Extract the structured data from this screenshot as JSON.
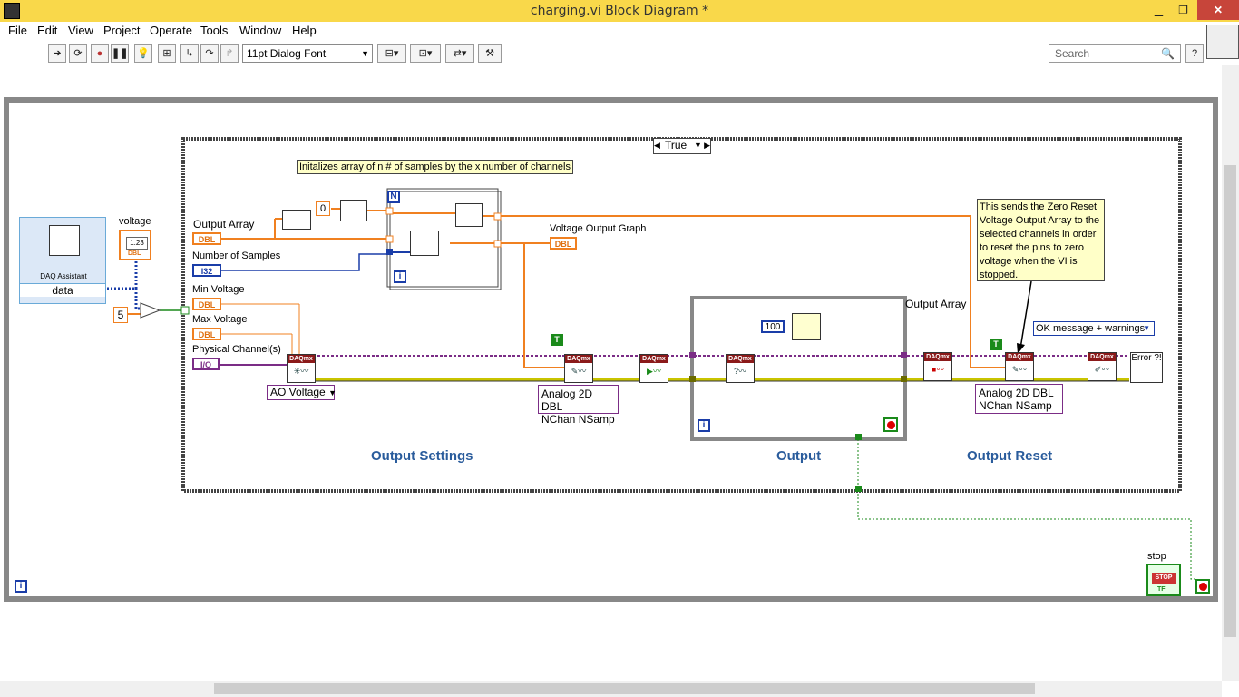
{
  "window": {
    "title": "charging.vi Block Diagram *",
    "minimize": "▁",
    "restore": "❐",
    "close": "✕"
  },
  "menu": [
    "File",
    "Edit",
    "View",
    "Project",
    "Operate",
    "Tools",
    "Window",
    "Help"
  ],
  "toolbar": {
    "font": "11pt Dialog Font",
    "search_placeholder": "Search"
  },
  "case_structure": {
    "selector": "True"
  },
  "comment": "Initalizes  array of n # of samples by the x number of channels",
  "note": "This sends the Zero Reset Voltage Output Array to the selected channels in order to reset the pins to zero voltage when the VI is stopped.",
  "labels": {
    "daq_assistant": "DAQ Assistant",
    "data": "data",
    "voltage": "voltage",
    "output_array": "Output Array",
    "output_array2": "Output Array",
    "number_of_samples": "Number of Samples",
    "min_voltage": "Min Voltage",
    "max_voltage": "Max Voltage",
    "physical_channels": "Physical Channel(s)",
    "voltage_output_graph": "Voltage Output Graph",
    "stop": "stop",
    "stop_btn": "STOP",
    "tf": "TF"
  },
  "constants": {
    "five": "5",
    "zero": "0",
    "hundred": "100",
    "true1": "T",
    "true2": "T"
  },
  "terminals": {
    "dbl": "DBL",
    "i32": "I32",
    "io": "I/O",
    "numeric": "1.23",
    "daqmx": "DAQmx"
  },
  "dropdowns": {
    "ao_voltage": "AO Voltage",
    "analog2d_1": [
      "Analog 2D DBL",
      "NChan NSamp"
    ],
    "analog2d_2": [
      "Analog 2D DBL",
      "NChan NSamp"
    ],
    "ok_message": "OK message + warnings"
  },
  "sections": {
    "settings": "Output Settings",
    "output": "Output",
    "reset": "Output Reset"
  },
  "misc": {
    "iter": "i",
    "n": "N",
    "error": "Error ?!"
  }
}
